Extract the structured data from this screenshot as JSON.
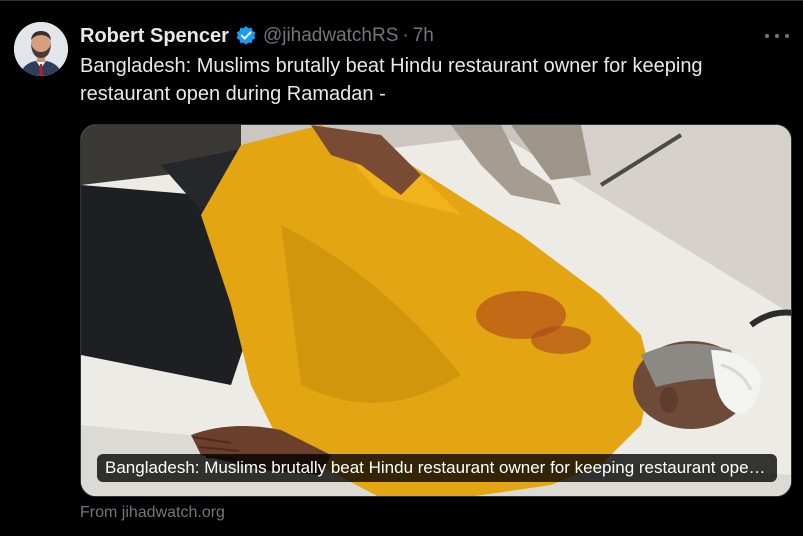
{
  "author": {
    "name": "Robert Spencer",
    "handle": "@jihadwatchRS",
    "separator": "·",
    "time": "7h",
    "verified": true
  },
  "tweet": {
    "text": "Bangladesh: Muslims brutally beat Hindu restaurant owner for keeping restaurant open during Ramadan -"
  },
  "media": {
    "caption": "Bangladesh: Muslims brutally beat Hindu restaurant owner for keeping restaurant open during Ramadan",
    "source": "From jihadwatch.org"
  },
  "icons": {
    "more": "more-options-icon",
    "verified": "verified-badge-icon"
  },
  "colors": {
    "background": "#000000",
    "text": "#e7e9ea",
    "secondary": "#71767b",
    "verified": "#1d9bf0",
    "border": "#2f3336"
  }
}
